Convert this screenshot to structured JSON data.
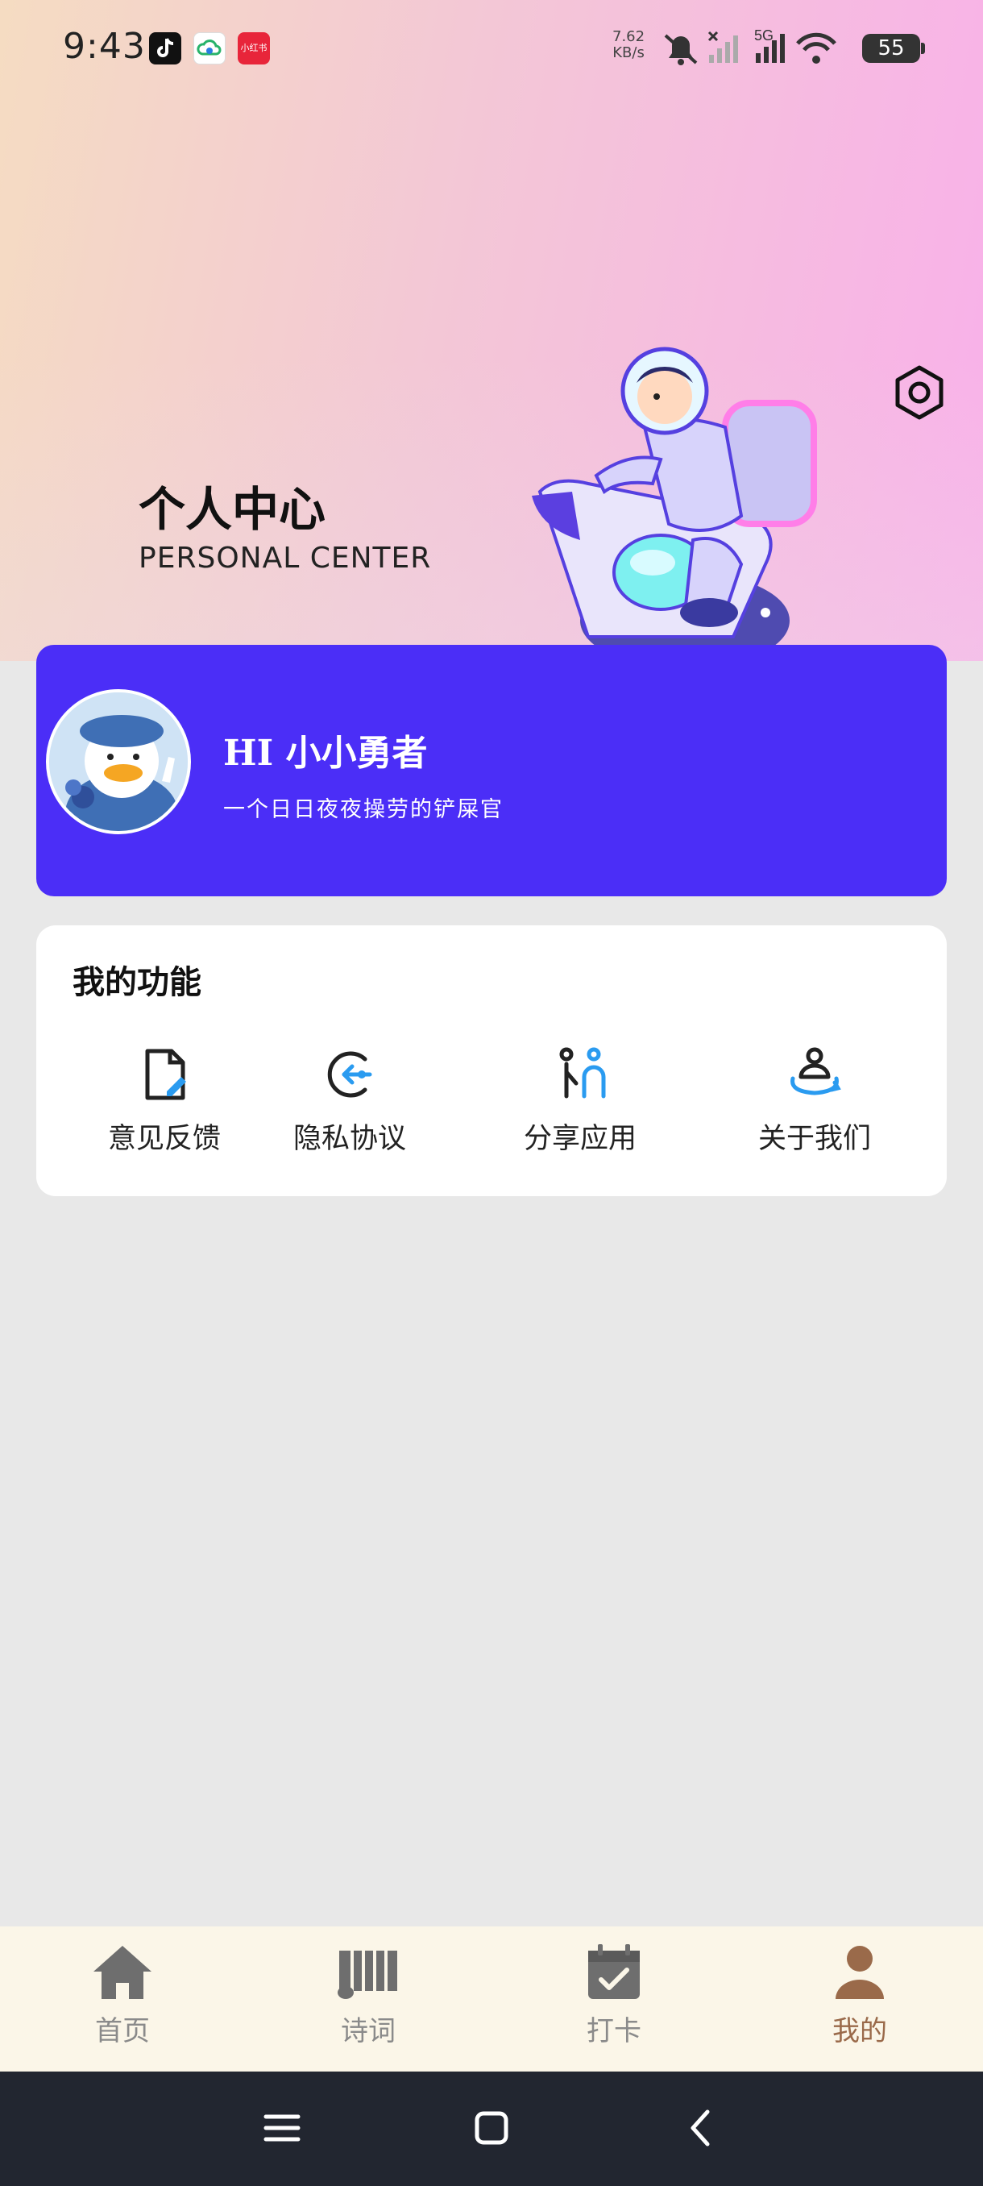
{
  "status_bar": {
    "time": "9:43",
    "net_speed_value": "7.62",
    "net_speed_unit": "KB/s",
    "network_type": "5G",
    "battery": "55",
    "xhs_label": "小红书"
  },
  "header": {
    "title_cn": "个人中心",
    "title_en": "PERSONAL CENTER"
  },
  "profile": {
    "greeting": "HI 小小勇者",
    "motto": "一个日日夜夜操劳的铲屎官"
  },
  "functions": {
    "title": "我的功能",
    "items": [
      {
        "label": "意见反馈",
        "icon": "feedback-icon"
      },
      {
        "label": "隐私协议",
        "icon": "privacy-icon"
      },
      {
        "label": "分享应用",
        "icon": "share-icon"
      },
      {
        "label": "关于我们",
        "icon": "about-icon"
      }
    ]
  },
  "tabbar": {
    "items": [
      {
        "label": "首页",
        "icon": "home-icon"
      },
      {
        "label": "诗词",
        "icon": "scroll-icon"
      },
      {
        "label": "打卡",
        "icon": "calendar-check-icon"
      },
      {
        "label": "我的",
        "icon": "user-icon",
        "active": true
      }
    ]
  },
  "colors": {
    "card_purple": "#4b2ef7",
    "tab_active": "#9a6a4a",
    "tab_inactive": "#8a8a8a",
    "icon_blue": "#2a9bf0"
  }
}
